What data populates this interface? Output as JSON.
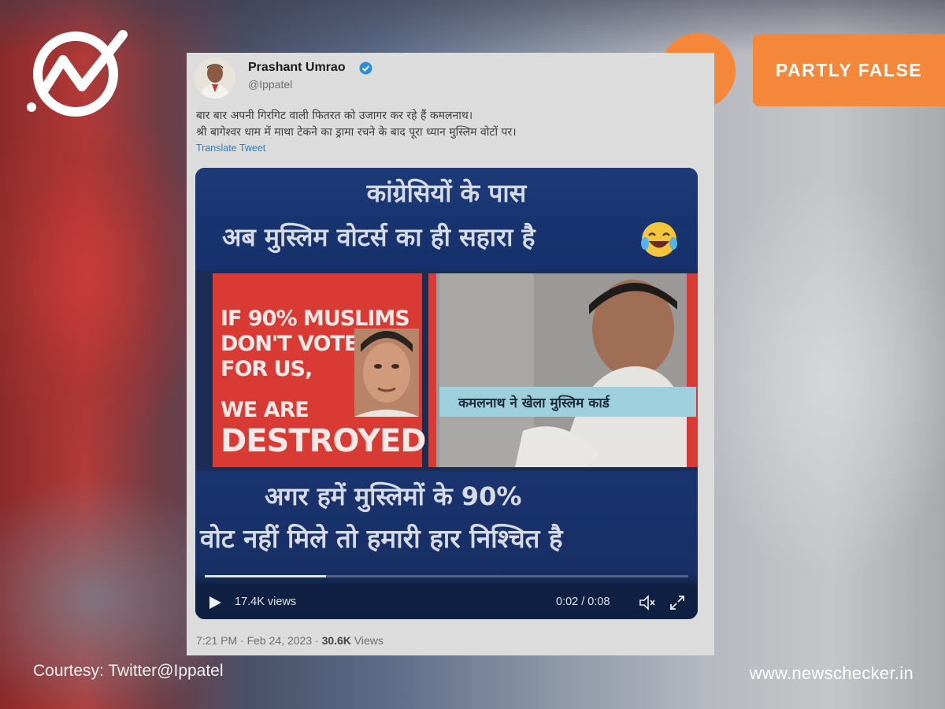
{
  "brand": {
    "site_url": "www.newschecker.in",
    "courtesy": "Courtesy: Twitter@Ippatel",
    "accent_color": "#f5873a"
  },
  "verdict": {
    "label": "PARTLY FALSE",
    "icon": "fact-check-icon"
  },
  "tweet": {
    "author_name": "Prashant Umrao",
    "author_handle": "@Ippatel",
    "verified": true,
    "text_line1": "बार बार अपनी गिरगिट वाली फितरत को उजागर कर रहे हैं कमलनाथ।",
    "text_line2": "श्री बागेश्वर धाम में माथा टेकने का ड्रामा रचने के बाद पूरा ध्यान मुस्लिम वोटों पर।",
    "translate_label": "Translate Tweet",
    "time": "7:21 PM",
    "date": "Feb 24, 2023",
    "separator": "·",
    "views_count": "30.6K",
    "views_word": "Views"
  },
  "media": {
    "headline_line1": "कांग्रेसियों के पास",
    "headline_line2": "अब मुस्लिम वोटर्स का ही सहारा है",
    "emoji": "laughing-tears-emoji",
    "panel_lines": [
      "IF 90% MUSLIMS",
      "DON'T VOTE",
      "FOR US,",
      "WE ARE",
      "DESTROYED"
    ],
    "caption": "कमलनाथ ने खेला मुस्लिम कार्ड",
    "footer_line1": "अगर हमें मुस्लिमों के 90%",
    "footer_line2": "वोट नहीं मिले तो हमारी हार निश्चित है"
  },
  "video_player": {
    "views": "17.4K views",
    "time": "0:02 / 0:08",
    "progress_fraction": 0.25
  }
}
